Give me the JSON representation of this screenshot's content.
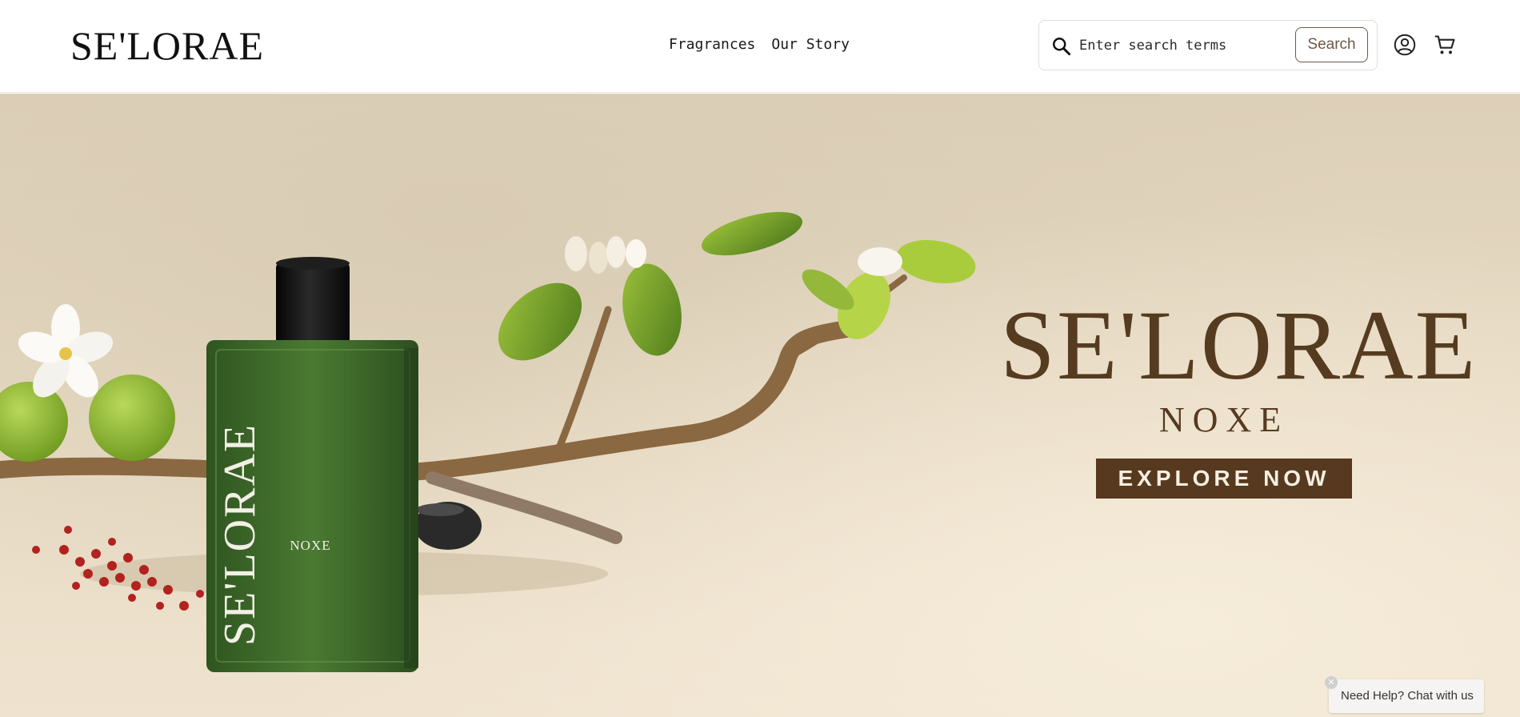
{
  "header": {
    "logo_text": "SE'LORAE",
    "nav": [
      {
        "label": "Fragrances"
      },
      {
        "label": "Our Story"
      }
    ],
    "search": {
      "placeholder": "Enter search terms",
      "value": "",
      "button_label": "Search",
      "icon": "search-icon"
    },
    "icons": {
      "account": "account-circle-icon",
      "cart": "shopping-cart-icon"
    }
  },
  "hero": {
    "brand": "SE'LORAE",
    "product": "NOXE",
    "cta_label": "EXPLORE NOW",
    "bottle_brand": "SE'LORAE",
    "bottle_label": "NOXE",
    "colors": {
      "brand_brown": "#553b20",
      "cta_background": "#56391f",
      "bottle_green": "#3e6a2a",
      "background_beige": "#e6d9c2"
    }
  },
  "chat_widget": {
    "label": "Need Help? Chat with us",
    "close_icon": "close-icon"
  }
}
